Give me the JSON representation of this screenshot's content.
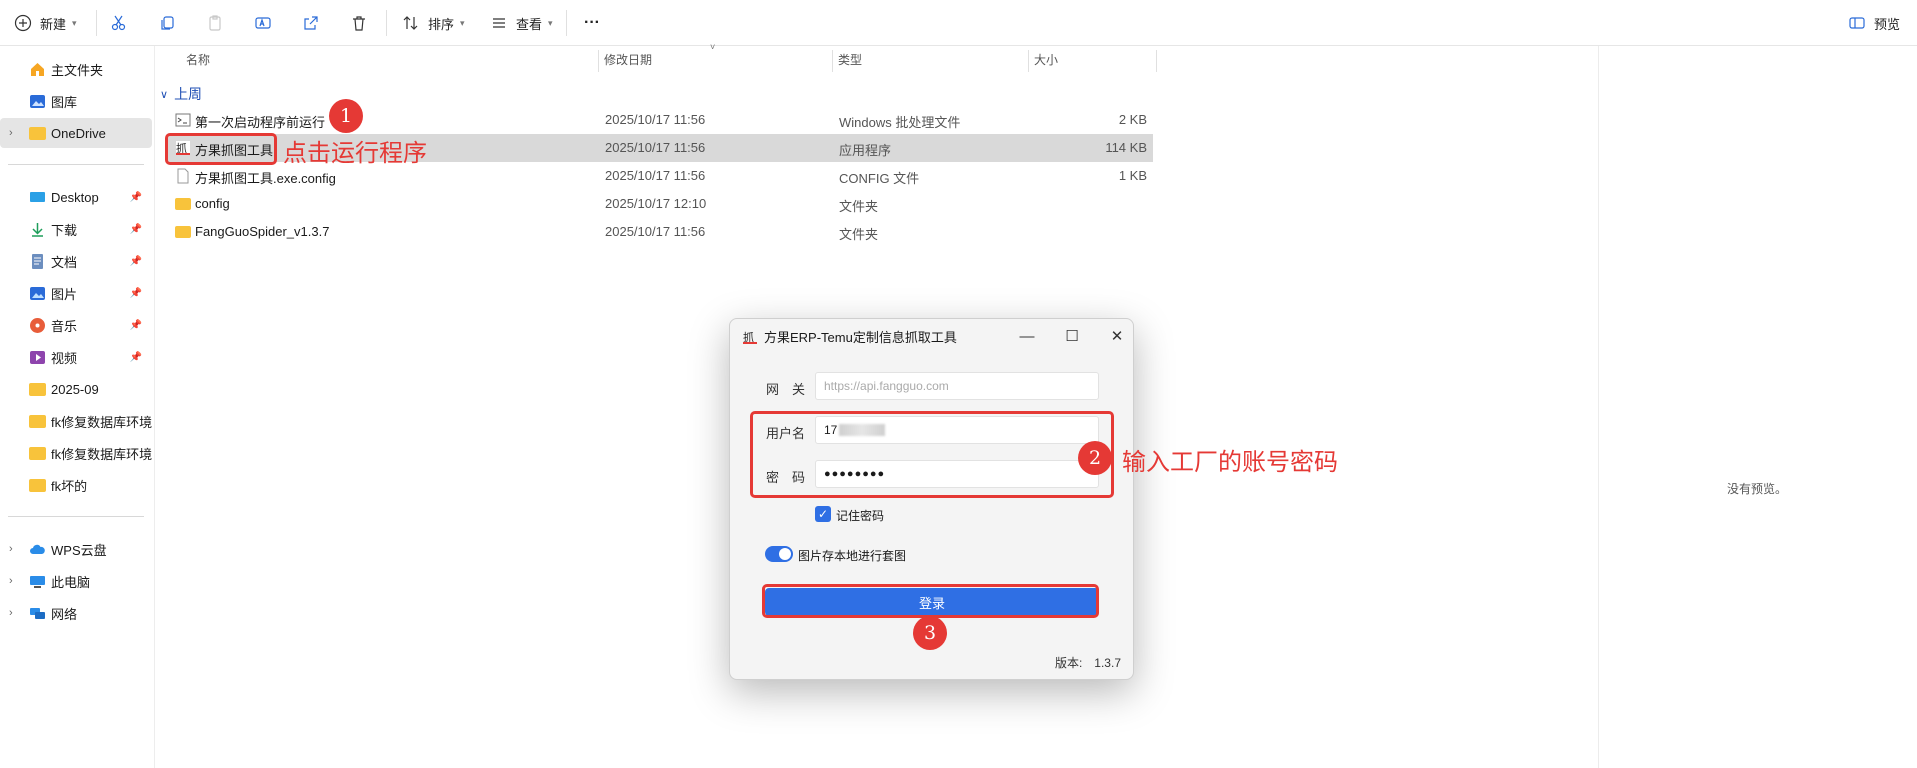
{
  "toolbar": {
    "new_label": "新建",
    "sort_label": "排序",
    "view_label": "查看",
    "more_label": "···",
    "preview_label": "预览"
  },
  "sidebar": {
    "items": [
      {
        "label": "主文件夹",
        "icon": "home-icon"
      },
      {
        "label": "图库",
        "icon": "gallery-icon"
      },
      {
        "label": "OneDrive",
        "icon": "folder-icon"
      },
      {
        "label": "Desktop",
        "icon": "desktop-icon"
      },
      {
        "label": "下载",
        "icon": "download-icon"
      },
      {
        "label": "文档",
        "icon": "document-icon"
      },
      {
        "label": "图片",
        "icon": "pictures-icon"
      },
      {
        "label": "音乐",
        "icon": "music-icon"
      },
      {
        "label": "视频",
        "icon": "video-icon"
      },
      {
        "label": "2025-09",
        "icon": "folder-icon"
      },
      {
        "label": "fk修复数据库环境",
        "icon": "folder-icon"
      },
      {
        "label": "fk修复数据库环境",
        "icon": "folder-icon"
      },
      {
        "label": "fk坏的",
        "icon": "folder-icon"
      },
      {
        "label": "WPS云盘",
        "icon": "cloud-icon"
      },
      {
        "label": "此电脑",
        "icon": "computer-icon"
      },
      {
        "label": "网络",
        "icon": "network-icon"
      }
    ]
  },
  "columns": {
    "name": "名称",
    "date": "修改日期",
    "type": "类型",
    "size": "大小"
  },
  "group_label": "上周",
  "files": [
    {
      "name": "第一次启动程序前运行",
      "date": "2025/10/17 11:56",
      "type": "Windows 批处理文件",
      "size": "2 KB"
    },
    {
      "name": "方果抓图工具",
      "date": "2025/10/17 11:56",
      "type": "应用程序",
      "size": "114 KB"
    },
    {
      "name": "方果抓图工具.exe.config",
      "date": "2025/10/17 11:56",
      "type": "CONFIG 文件",
      "size": "1 KB"
    },
    {
      "name": "config",
      "date": "2025/10/17 12:10",
      "type": "文件夹",
      "size": ""
    },
    {
      "name": "FangGuoSpider_v1.3.7",
      "date": "2025/10/17 11:56",
      "type": "文件夹",
      "size": ""
    }
  ],
  "preview": {
    "empty_text": "没有预览。"
  },
  "annotations": {
    "step1_num": "1",
    "step1_text": "点击运行程序",
    "step2_num": "2",
    "step2_text": "输入工厂的账号密码",
    "step3_num": "3"
  },
  "dialog": {
    "title": "方果ERP-Temu定制信息抓取工具",
    "gateway_label": "网　关",
    "gateway_placeholder": "https://api.fangguo.com",
    "username_label": "用户名",
    "username_value": "17",
    "password_label": "密　码",
    "password_value": "●●●●●●●●",
    "remember_label": "记住密码",
    "toggle_label": "图片存本地进行套图",
    "login_label": "登录",
    "version_text": "版本:　1.3.7"
  }
}
